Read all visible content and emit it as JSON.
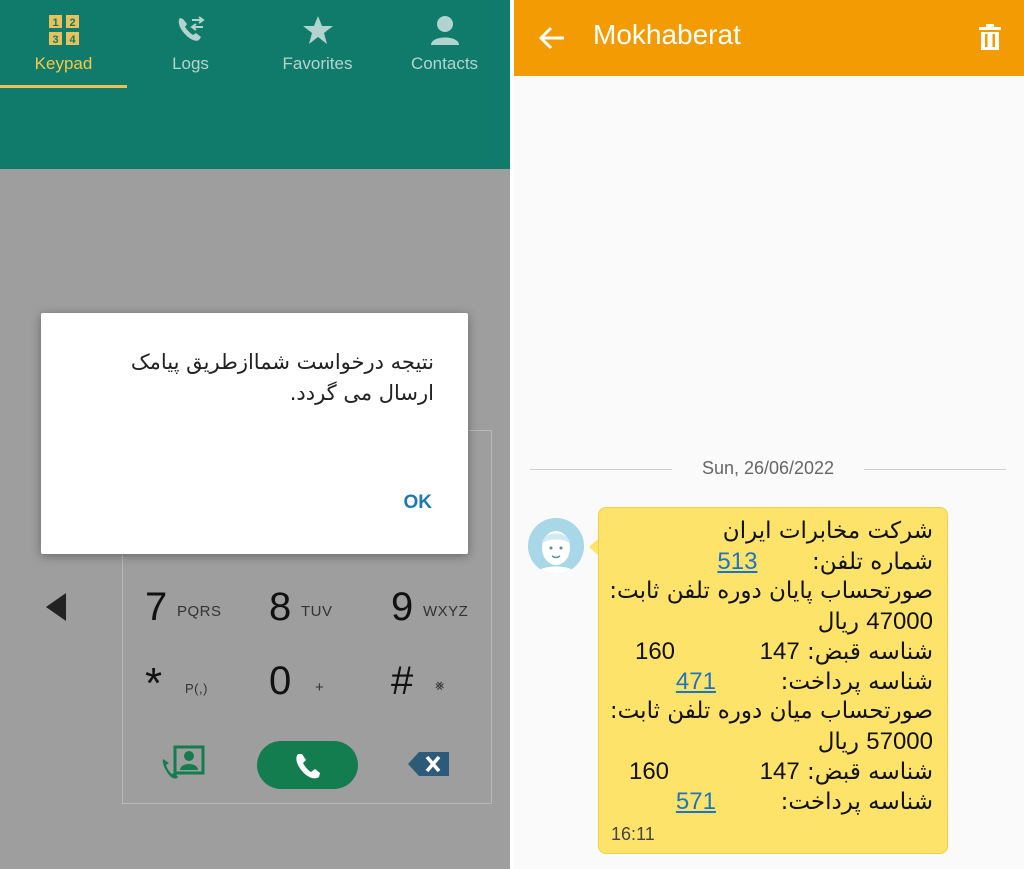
{
  "dialer": {
    "tabs": [
      {
        "label": "Keypad",
        "icon": "keypad-icon",
        "active": true
      },
      {
        "label": "Logs",
        "icon": "call-log-icon",
        "active": false
      },
      {
        "label": "Favorites",
        "icon": "star-icon",
        "active": false
      },
      {
        "label": "Contacts",
        "icon": "contact-person-icon",
        "active": false
      }
    ],
    "keys": [
      {
        "digit": "7",
        "letters": "PQRS"
      },
      {
        "digit": "8",
        "letters": "TUV"
      },
      {
        "digit": "9",
        "letters": "WXYZ"
      },
      {
        "digit": "*",
        "letters": "P(,)"
      },
      {
        "digit": "0",
        "letters": "+"
      },
      {
        "digit": "#",
        "letters": "⨳"
      }
    ],
    "accent": "#107b6a",
    "call_color": "#147d4f"
  },
  "dialog": {
    "message": "نتیجه درخواست شماازطریق پیامک ارسال می گردد.",
    "ok_label": "OK"
  },
  "messages": {
    "title": "Mokhaberat",
    "header_color": "#f39b02",
    "date": "Sun, 26/06/2022",
    "time": "16:11",
    "bubble_color": "#fde36a",
    "lines": {
      "l1": "شرکت مخابرات ایران",
      "l2_label": "شماره تلفن:",
      "l2_link": "513",
      "l3": "صورتحساب پایان دوره تلفن ثابت:",
      "l4_amount": "47000",
      "l4_unit": "ریال",
      "l5_label": "شناسه قبض:",
      "l5_a": "147",
      "l5_b": "160",
      "l6_label": "شناسه پرداخت:",
      "l6_link": "471",
      "l7": "صورتحساب میان دوره تلفن ثابت:",
      "l8_amount": "57000",
      "l8_unit": "ریال",
      "l9_label": "شناسه قبض:",
      "l9_a": "147",
      "l9_b": "160",
      "l10_label": "شناسه پرداخت:",
      "l10_link": "571"
    }
  }
}
